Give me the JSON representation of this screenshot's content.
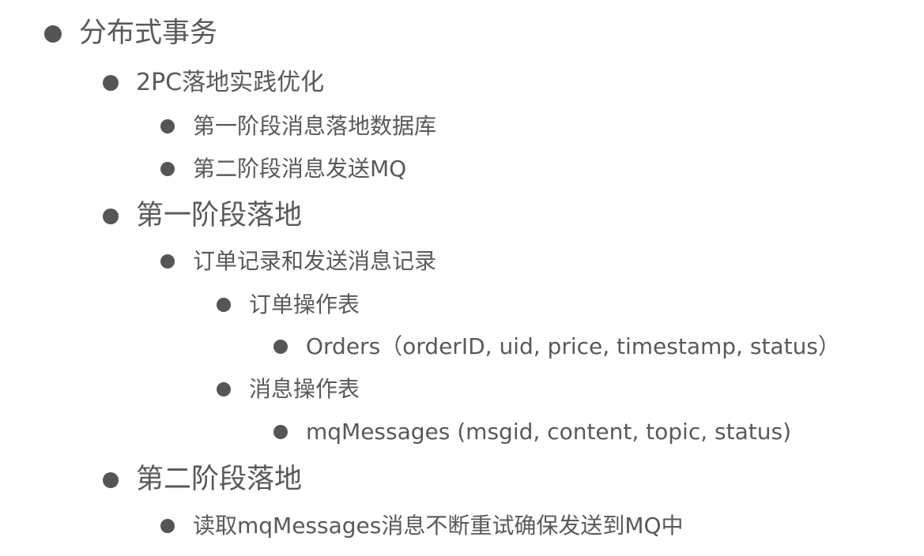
{
  "outline": {
    "items": [
      {
        "text": "分布式事务"
      },
      {
        "text": "2PC落地实践优化"
      },
      {
        "text": "第一阶段消息落地数据库"
      },
      {
        "text": "第二阶段消息发送MQ"
      },
      {
        "text": "第一阶段落地"
      },
      {
        "text": "订单记录和发送消息记录"
      },
      {
        "text": "订单操作表"
      },
      {
        "text": "Orders（orderID, uid, price, timestamp, status）"
      },
      {
        "text": "消息操作表"
      },
      {
        "text": "mqMessages (msgid, content, topic, status)"
      },
      {
        "text": "第二阶段落地"
      },
      {
        "text": "读取mqMessages消息不断重试确保发送到MQ中"
      }
    ]
  }
}
